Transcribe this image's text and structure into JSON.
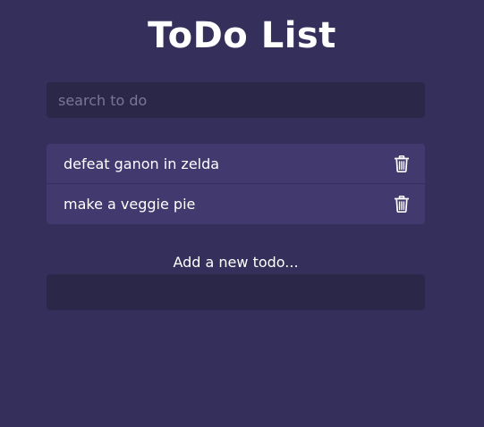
{
  "app": {
    "title": "ToDo List"
  },
  "search": {
    "placeholder": "search to do",
    "value": ""
  },
  "todos": [
    {
      "text": "defeat ganon in zelda",
      "icon": "trash-icon"
    },
    {
      "text": "make a veggie pie",
      "icon": "trash-icon"
    }
  ],
  "add": {
    "label": "Add a new todo...",
    "value": ""
  },
  "colors": {
    "background": "#352f5b",
    "input_background": "#2b2749",
    "item_background": "#423a6f",
    "text": "#ffffff",
    "placeholder": "#7b7698"
  }
}
